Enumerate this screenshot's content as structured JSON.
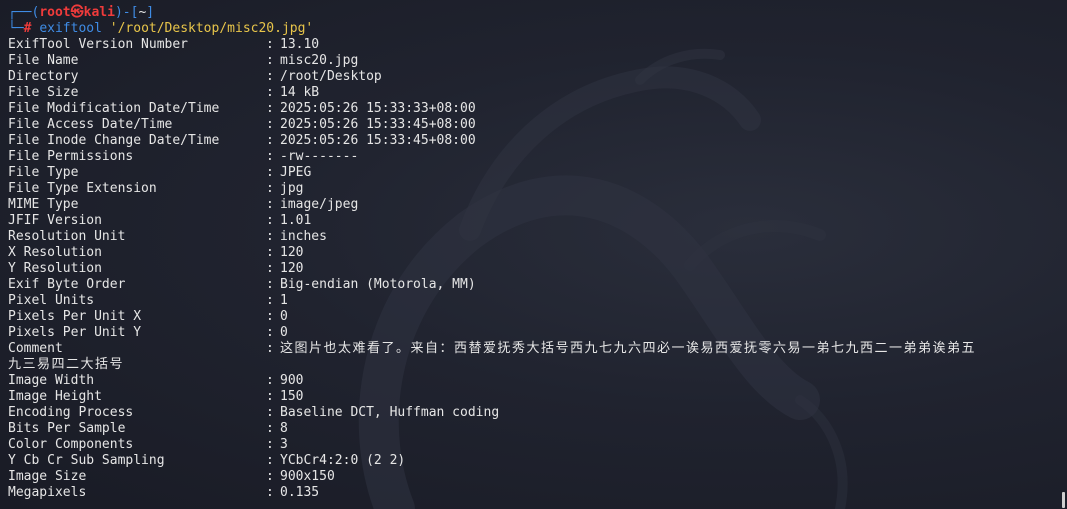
{
  "prompt": {
    "open_bracket": "┌──(",
    "user": "root",
    "at": "㉿",
    "host": "kali",
    "mid": ")-[",
    "cwd": "~",
    "close": "]",
    "line2_prefix": "└─",
    "hash": "#",
    "command": "exiftool",
    "argument": "'/root/Desktop/misc20.jpg'"
  },
  "separator": ":",
  "rows": [
    {
      "key": "ExifTool Version Number",
      "value": "13.10"
    },
    {
      "key": "File Name",
      "value": "misc20.jpg"
    },
    {
      "key": "Directory",
      "value": "/root/Desktop"
    },
    {
      "key": "File Size",
      "value": "14 kB"
    },
    {
      "key": "File Modification Date/Time",
      "value": "2025:05:26 15:33:33+08:00"
    },
    {
      "key": "File Access Date/Time",
      "value": "2025:05:26 15:33:45+08:00"
    },
    {
      "key": "File Inode Change Date/Time",
      "value": "2025:05:26 15:33:45+08:00"
    },
    {
      "key": "File Permissions",
      "value": "-rw-------"
    },
    {
      "key": "File Type",
      "value": "JPEG"
    },
    {
      "key": "File Type Extension",
      "value": "jpg"
    },
    {
      "key": "MIME Type",
      "value": "image/jpeg"
    },
    {
      "key": "JFIF Version",
      "value": "1.01"
    },
    {
      "key": "Resolution Unit",
      "value": "inches"
    },
    {
      "key": "X Resolution",
      "value": "120"
    },
    {
      "key": "Y Resolution",
      "value": "120"
    },
    {
      "key": "Exif Byte Order",
      "value": "Big-endian (Motorola, MM)"
    },
    {
      "key": "Pixel Units",
      "value": "1"
    },
    {
      "key": "Pixels Per Unit X",
      "value": "0"
    },
    {
      "key": "Pixels Per Unit Y",
      "value": "0"
    }
  ],
  "comment": {
    "key": "Comment",
    "value_line1": "这图片也太难看了。来自：西替爱抚秀大括号西九七九六四必一诶易西爱抚零六易一弟七九西二一弟弟诶弟五",
    "value_line2": "九三易四二大括号"
  },
  "rows_after": [
    {
      "key": "Image Width",
      "value": "900"
    },
    {
      "key": "Image Height",
      "value": "150"
    },
    {
      "key": "Encoding Process",
      "value": "Baseline DCT, Huffman coding"
    },
    {
      "key": "Bits Per Sample",
      "value": "8"
    },
    {
      "key": "Color Components",
      "value": "3"
    },
    {
      "key": "Y Cb Cr Sub Sampling",
      "value": "YCbCr4:2:0 (2 2)"
    },
    {
      "key": "Image Size",
      "value": "900x150"
    },
    {
      "key": "Megapixels",
      "value": "0.135"
    }
  ],
  "colors": {
    "background": "#1b1e29",
    "prompt_blue": "#3f8ce5",
    "prompt_red": "#ef3b3b",
    "argument_yellow": "#e8c54a",
    "text": "#e6e6e6"
  },
  "icons": [
    "kali-dragon-watermark"
  ]
}
